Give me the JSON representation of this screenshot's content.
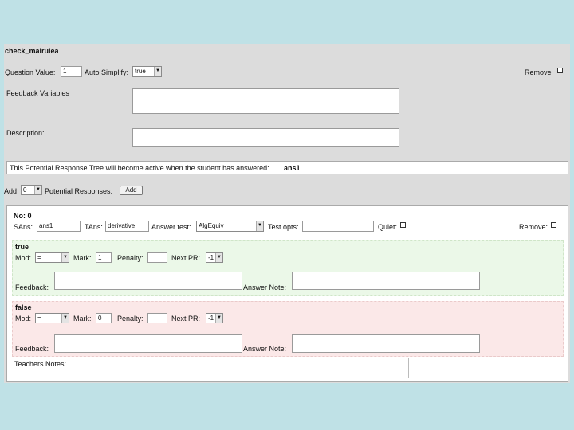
{
  "header": {
    "title": "check_malrulea"
  },
  "question": {
    "value_label": "Question Value:",
    "value": "1",
    "auto_simplify_label": "Auto Simplify:",
    "auto_simplify_value": "true",
    "remove_label": "Remove",
    "feedback_variables_label": "Feedback Variables",
    "description_label": "Description:"
  },
  "info": {
    "text": "This Potential Response Tree will become active when the student has answered:",
    "answer": "ans1"
  },
  "add_row": {
    "add_label": "Add",
    "count": "0",
    "responses_label": "Potential Responses:",
    "button_label": "Add"
  },
  "node": {
    "title": "No: 0",
    "sans_label": "SAns:",
    "sans_value": "ans1",
    "tans_label": "TAns:",
    "tans_value": "derivative",
    "answer_test_label": "Answer test:",
    "answer_test_value": "AlgEquiv",
    "test_opts_label": "Test opts:",
    "quiet_label": "Quiet:",
    "remove_label": "Remove:",
    "true_branch": {
      "title": "true",
      "mod_label": "Mod:",
      "mod_value": "=",
      "mark_label": "Mark:",
      "mark_value": "1",
      "penalty_label": "Penalty:",
      "penalty_value": "",
      "next_label": "Next PR:",
      "next_value": "-1",
      "feedback_label": "Feedback:",
      "answer_note_label": "Answer Note:"
    },
    "false_branch": {
      "title": "false",
      "mod_label": "Mod:",
      "mod_value": "=",
      "mark_label": "Mark:",
      "mark_value": "0",
      "penalty_label": "Penalty:",
      "penalty_value": "",
      "next_label": "Next PR:",
      "next_value": "-1",
      "feedback_label": "Feedback:",
      "answer_note_label": "Answer Note:"
    },
    "teachers_notes_label": "Teachers Notes:"
  }
}
